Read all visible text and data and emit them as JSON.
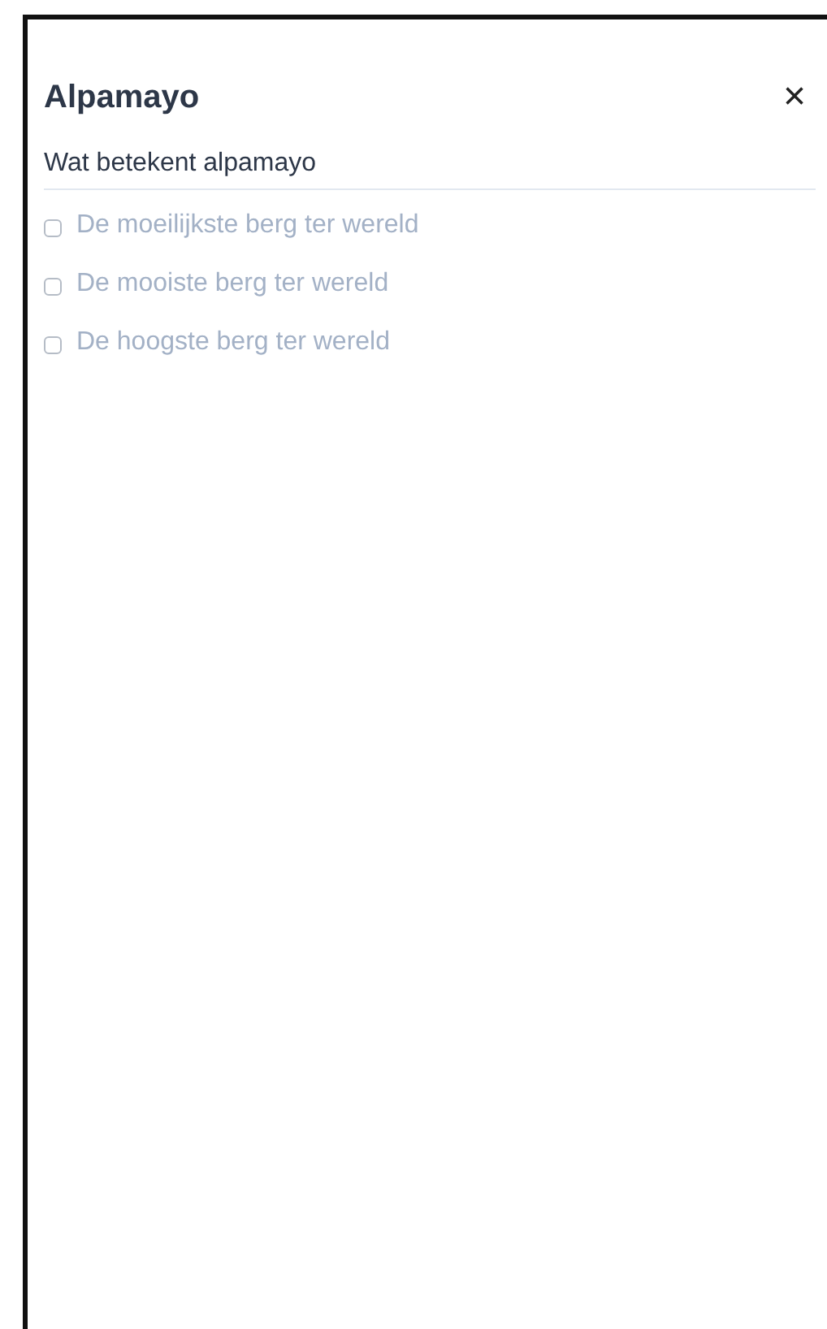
{
  "panel": {
    "title": "Alpamayo",
    "close": "×"
  },
  "question": "Wat betekent alpamayo",
  "options": [
    {
      "label": "De moeilijkste berg ter wereld",
      "checked": false
    },
    {
      "label": "De mooiste berg ter wereld",
      "checked": false
    },
    {
      "label": "De hoogste berg ter wereld",
      "checked": false
    }
  ]
}
